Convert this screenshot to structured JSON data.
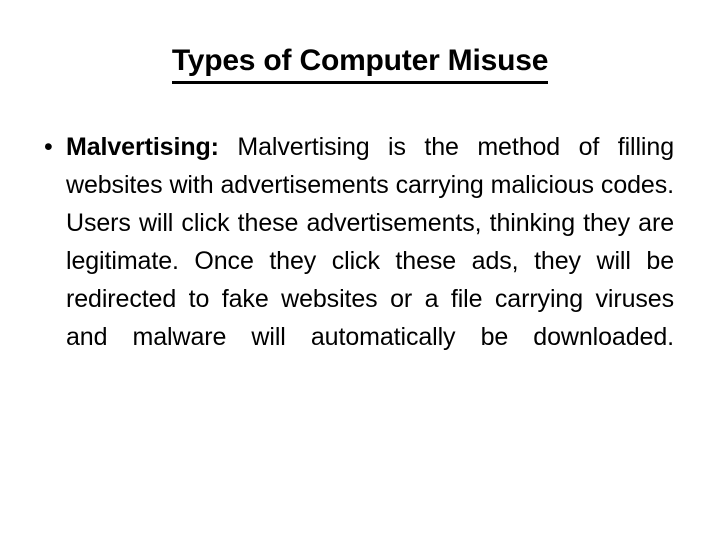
{
  "slide": {
    "title": "Types of Computer Misuse",
    "bullets": [
      {
        "marker": "•",
        "term": "Malvertising:",
        "text": " Malvertising is the method of filling websites with advertisements carrying malicious codes. Users will click these advertisements, thinking they are legitimate. Once they click these ads, they will be redirected to fake websites or a file carrying viruses and malware will automatically be downloaded."
      }
    ]
  },
  "colors": {
    "background": "#ffffff",
    "text": "#000000",
    "title": "#000000",
    "underline": "#000000"
  }
}
